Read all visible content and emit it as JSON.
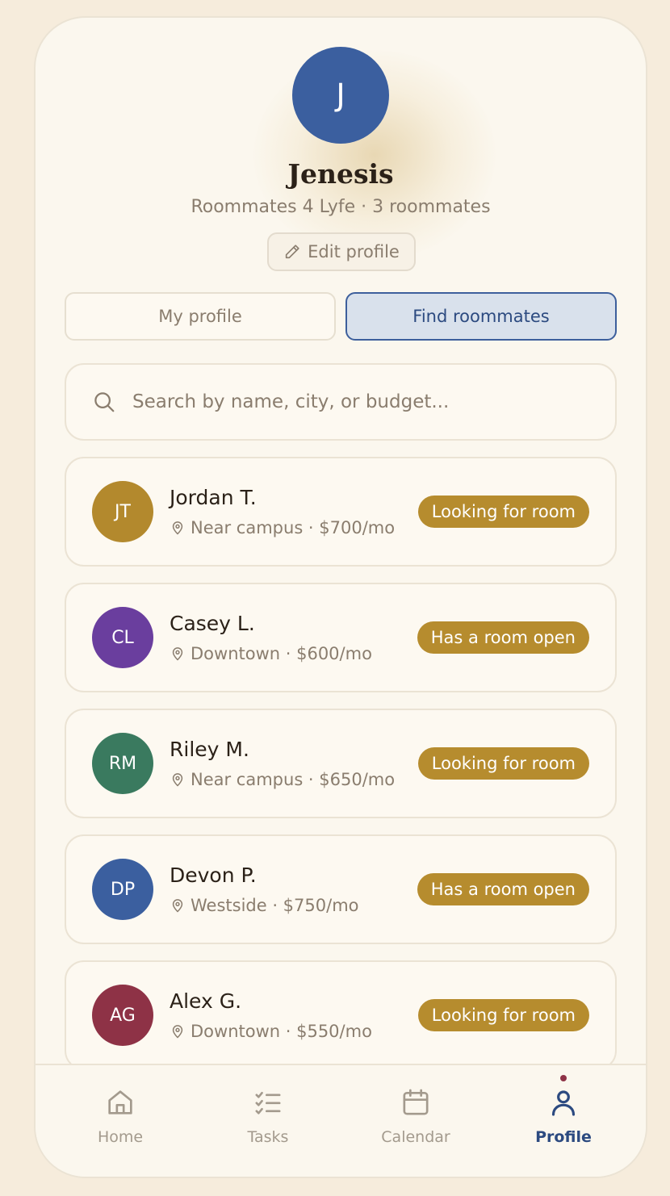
{
  "profile": {
    "initial": "J",
    "name": "Jenesis",
    "subtitle": "Roommates 4 Lyfe · 3 roommates",
    "edit_label": "Edit profile",
    "avatar_color": "#3b5f9f"
  },
  "tabs": {
    "my_profile": "My profile",
    "find_roommates": "Find roommates",
    "active": "find_roommates"
  },
  "search": {
    "placeholder": "Search by name, city, or budget..."
  },
  "roommates": [
    {
      "initials": "JT",
      "name": "Jordan T.",
      "location": "Near campus · $700/mo",
      "status": "Looking for room",
      "color": "#b3892d"
    },
    {
      "initials": "CL",
      "name": "Casey L.",
      "location": "Downtown · $600/mo",
      "status": "Has a room open",
      "color": "#6a3e9e"
    },
    {
      "initials": "RM",
      "name": "Riley M.",
      "location": "Near campus · $650/mo",
      "status": "Looking for room",
      "color": "#3a7a5f"
    },
    {
      "initials": "DP",
      "name": "Devon P.",
      "location": "Westside · $750/mo",
      "status": "Has a room open",
      "color": "#3b5f9f"
    },
    {
      "initials": "AG",
      "name": "Alex G.",
      "location": "Downtown · $550/mo",
      "status": "Looking for room",
      "color": "#8e3246"
    }
  ],
  "nav": {
    "home": "Home",
    "tasks": "Tasks",
    "calendar": "Calendar",
    "profile": "Profile",
    "active": "profile"
  },
  "colors": {
    "accent": "#2c4a80",
    "badge": "#b68c2e",
    "background": "#f6ecdc"
  }
}
